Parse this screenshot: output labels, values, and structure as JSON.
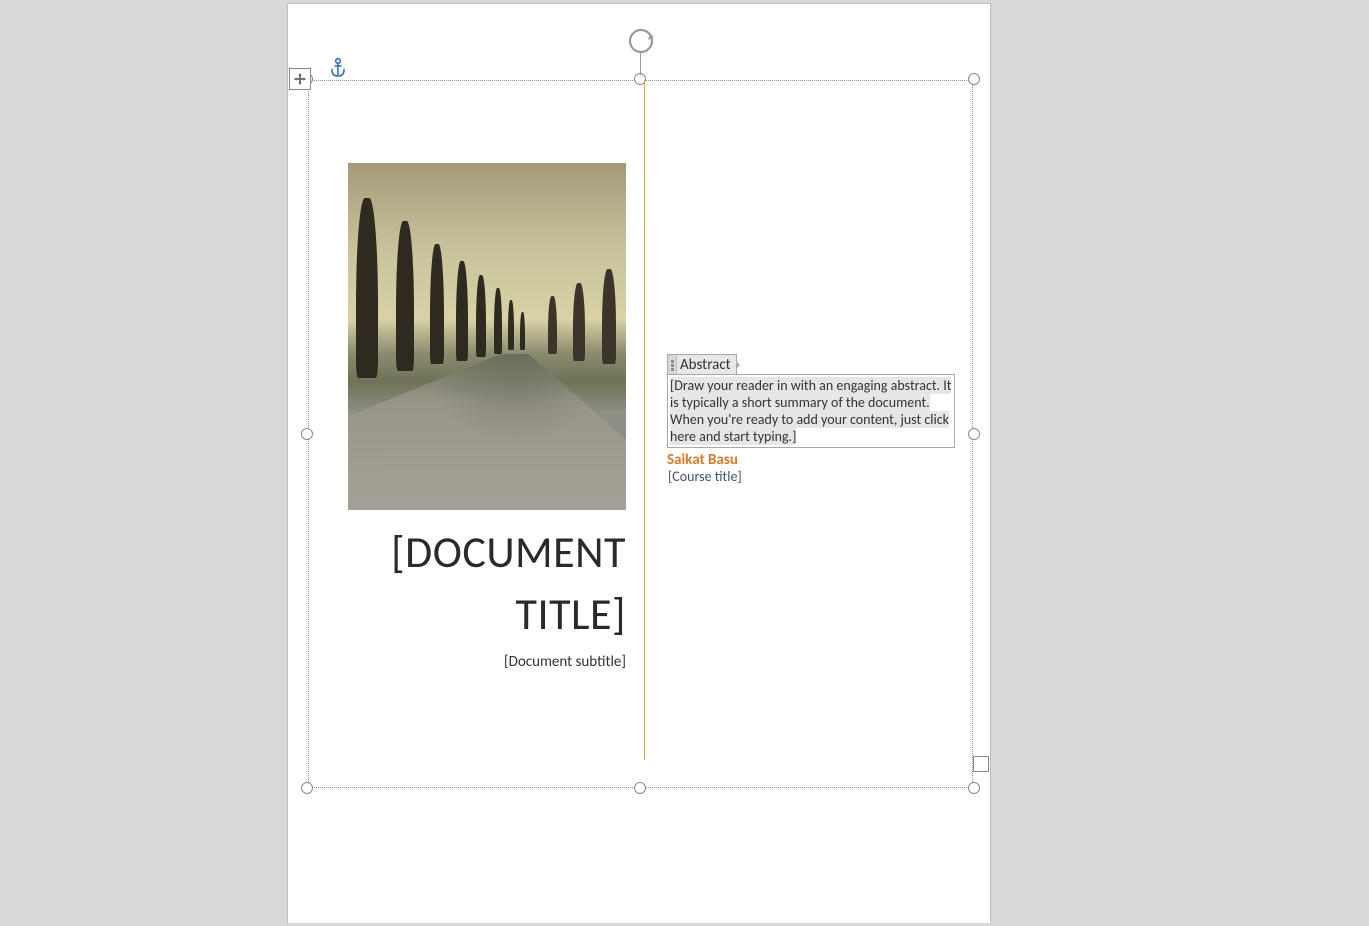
{
  "document": {
    "title_placeholder": "[DOCUMENT TITLE]",
    "subtitle_placeholder": "[Document subtitle]",
    "author": "Saikat Basu",
    "course_title_placeholder": "[Course title]"
  },
  "abstract": {
    "tag_label": "Abstract",
    "placeholder_text": "[Draw your reader in with an engaging abstract. It is typically a short summary of the document. When you're ready to add your content, just click here and start typing.]"
  },
  "icons": {
    "rotate": "rotate-handle-icon",
    "move": "move-handle-icon",
    "anchor": "anchor-icon"
  }
}
